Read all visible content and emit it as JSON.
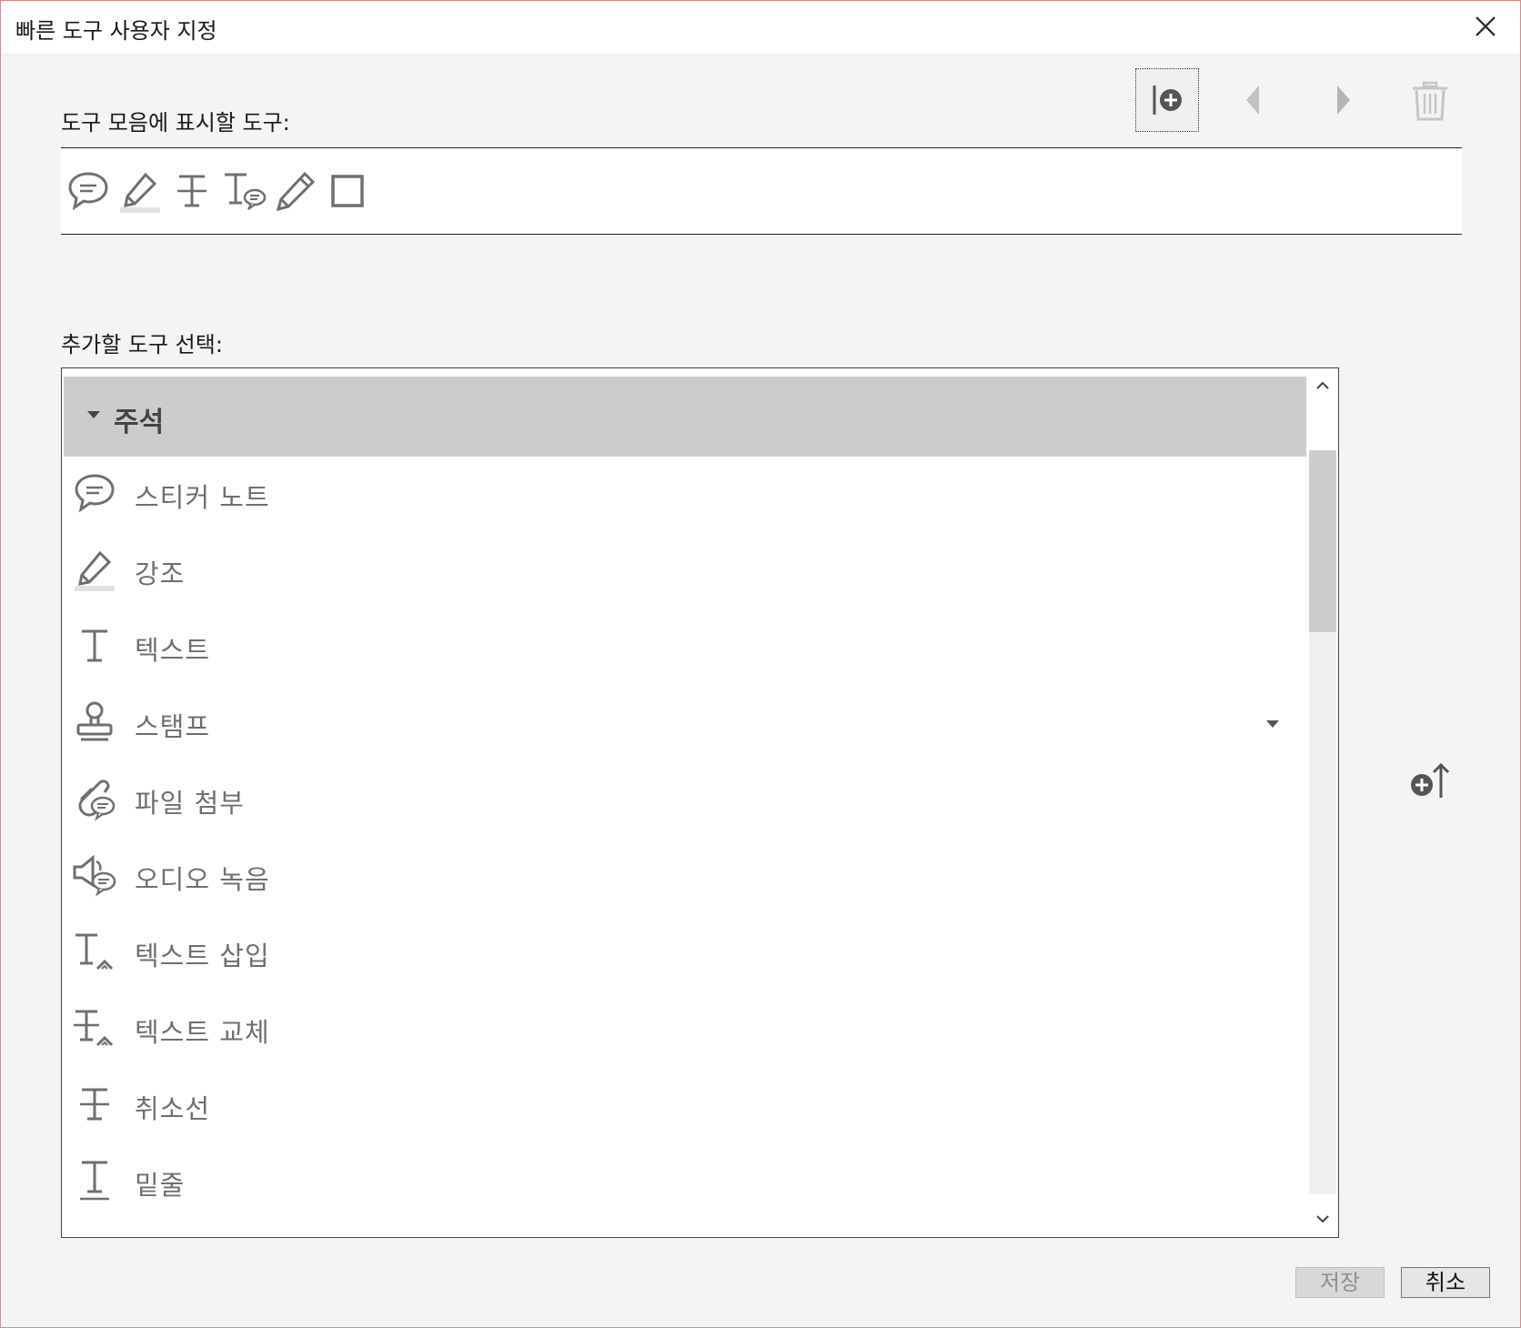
{
  "window": {
    "title": "빠른 도구 사용자 지정"
  },
  "toolbar_section": {
    "label": "도구 모음에 표시할 도구:",
    "buttons": [
      {
        "name": "add-to-toolbar",
        "icon": "insert-add-icon"
      },
      {
        "name": "move-left",
        "icon": "arrow-left-icon"
      },
      {
        "name": "move-right",
        "icon": "arrow-right-icon"
      },
      {
        "name": "delete",
        "icon": "trash-icon"
      }
    ],
    "tools": [
      "sticky-note-icon",
      "highlight-icon",
      "strikethrough-icon",
      "text-comment-icon",
      "pencil-icon",
      "rectangle-icon"
    ]
  },
  "select_section": {
    "label": "추가할 도구 선택:",
    "group": {
      "label": "주석",
      "expanded": true
    },
    "items": [
      {
        "label": "스티커 노트",
        "icon": "sticky-note-icon"
      },
      {
        "label": "강조",
        "icon": "highlight-icon"
      },
      {
        "label": "텍스트",
        "icon": "text-icon"
      },
      {
        "label": "스탬프",
        "icon": "stamp-icon",
        "has_dropdown": true
      },
      {
        "label": "파일 첨부",
        "icon": "attach-file-icon"
      },
      {
        "label": "오디오 녹음",
        "icon": "audio-record-icon"
      },
      {
        "label": "텍스트 삽입",
        "icon": "insert-text-icon"
      },
      {
        "label": "텍스트 교체",
        "icon": "replace-text-icon"
      },
      {
        "label": "취소선",
        "icon": "strikethrough-icon"
      },
      {
        "label": "밑줄",
        "icon": "underline-icon"
      }
    ]
  },
  "buttons": {
    "save": "저장",
    "cancel": "취소"
  },
  "colors": {
    "icon_gray": "#6f6f6f",
    "header_bg": "#cccccc",
    "dialog_bg": "#f4f4f4"
  }
}
